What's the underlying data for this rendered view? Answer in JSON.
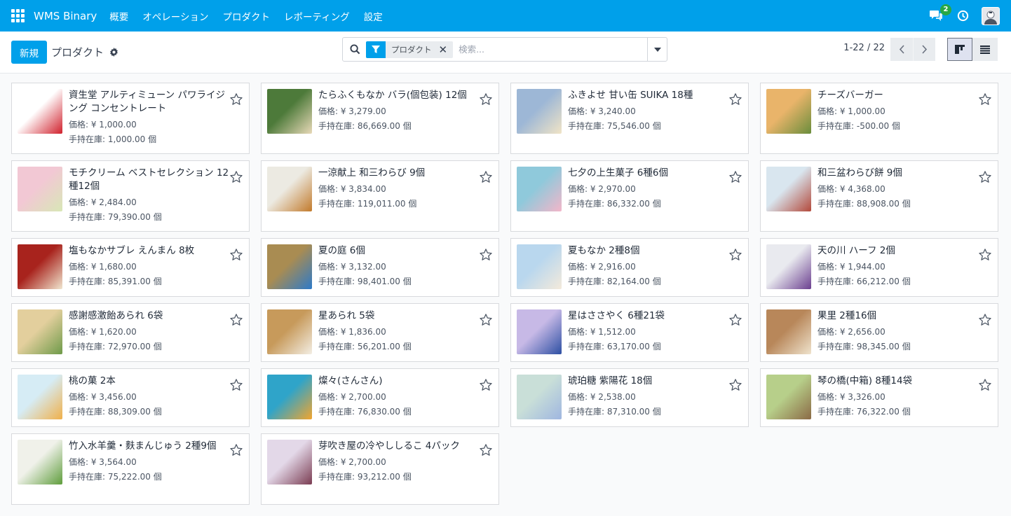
{
  "navbar": {
    "brand": "WMS Binary",
    "menu": [
      "概要",
      "オペレーション",
      "プロダクト",
      "レポーティング",
      "設定"
    ],
    "chat_badge": "2"
  },
  "control": {
    "new_label": "新規",
    "breadcrumb": "プロダクト",
    "facet_label": "プロダクト",
    "search_placeholder": "検索...",
    "pager": "1-22 / 22"
  },
  "colors": {
    "primary": "#00a0ea",
    "badge": "#28a745"
  },
  "products": [
    {
      "name": "資生堂 アルティミューン パワライジング コンセントレート",
      "price": "価格: ¥ 1,000.00",
      "stock": "手持在庫: 1,000.00 個",
      "thumb": [
        "#ffffff",
        "#d0202c"
      ]
    },
    {
      "name": "たらふくもなか バラ(個包装) 12個",
      "price": "価格: ¥ 3,279.00",
      "stock": "手持在庫: 86,669.00 個",
      "thumb": [
        "#4d7a3a",
        "#e8d9b8"
      ]
    },
    {
      "name": "ふきよせ 甘い缶 SUIKA 18種",
      "price": "価格: ¥ 3,240.00",
      "stock": "手持在庫: 75,546.00 個",
      "thumb": [
        "#9db7d6",
        "#f1e4c6"
      ]
    },
    {
      "name": "チーズバーガー",
      "price": "価格: ¥ 1,000.00",
      "stock": "手持在庫: -500.00 個",
      "thumb": [
        "#e9b46a",
        "#6a8d3c"
      ]
    },
    {
      "name": "モチクリーム ベストセレクション 12種12個",
      "price": "価格: ¥ 2,484.00",
      "stock": "手持在庫: 79,390.00 個",
      "thumb": [
        "#f2c8d4",
        "#d8e7b6"
      ]
    },
    {
      "name": "一涼献上 和三わらび 9個",
      "price": "価格: ¥ 3,834.00",
      "stock": "手持在庫: 119,011.00 個",
      "thumb": [
        "#eceae2",
        "#c27a2b"
      ]
    },
    {
      "name": "七夕の上生菓子 6種6個",
      "price": "価格: ¥ 2,970.00",
      "stock": "手持在庫: 86,332.00 個",
      "thumb": [
        "#8fc9db",
        "#f3b6c9"
      ]
    },
    {
      "name": "和三盆わらび餅 9個",
      "price": "価格: ¥ 4,368.00",
      "stock": "手持在庫: 88,908.00 個",
      "thumb": [
        "#d9e6ef",
        "#b3493b"
      ]
    },
    {
      "name": "塩もなかサブレ えんまん 8枚",
      "price": "価格: ¥ 1,680.00",
      "stock": "手持在庫: 85,391.00 個",
      "thumb": [
        "#a8231d",
        "#f0e6cf"
      ]
    },
    {
      "name": "夏の庭 6個",
      "price": "価格: ¥ 3,132.00",
      "stock": "手持在庫: 98,401.00 個",
      "thumb": [
        "#a98c52",
        "#2d7ac9"
      ]
    },
    {
      "name": "夏もなか 2種8個",
      "price": "価格: ¥ 2,916.00",
      "stock": "手持在庫: 82,164.00 個",
      "thumb": [
        "#b9d7ee",
        "#f4eadb"
      ]
    },
    {
      "name": "天の川 ハーフ 2個",
      "price": "価格: ¥ 1,944.00",
      "stock": "手持在庫: 66,212.00 個",
      "thumb": [
        "#e9eaef",
        "#6b3f8f"
      ]
    },
    {
      "name": "感謝感激飴あられ 6袋",
      "price": "価格: ¥ 1,620.00",
      "stock": "手持在庫: 72,970.00 個",
      "thumb": [
        "#e3cf9d",
        "#6e9a49"
      ]
    },
    {
      "name": "星あられ 5袋",
      "price": "価格: ¥ 1,836.00",
      "stock": "手持在庫: 56,201.00 個",
      "thumb": [
        "#c79a5b",
        "#f3eee4"
      ]
    },
    {
      "name": "星はささやく 6種21袋",
      "price": "価格: ¥ 1,512.00",
      "stock": "手持在庫: 63,170.00 個",
      "thumb": [
        "#c7b9e6",
        "#2d4fa3"
      ]
    },
    {
      "name": "果里 2種16個",
      "price": "価格: ¥ 2,656.00",
      "stock": "手持在庫: 98,345.00 個",
      "thumb": [
        "#b8875a",
        "#efe3cd"
      ]
    },
    {
      "name": "桃の菓 2本",
      "price": "価格: ¥ 3,456.00",
      "stock": "手持在庫: 88,309.00 個",
      "thumb": [
        "#d6ecf5",
        "#f0b04a"
      ]
    },
    {
      "name": "燦々(さんさん)",
      "price": "価格: ¥ 2,700.00",
      "stock": "手持在庫: 76,830.00 個",
      "thumb": [
        "#2fa4c9",
        "#f2a52e"
      ]
    },
    {
      "name": "琥珀糖 紫陽花 18個",
      "price": "価格: ¥ 2,538.00",
      "stock": "手持在庫: 87,310.00 個",
      "thumb": [
        "#c9dfd8",
        "#9fb6e0"
      ]
    },
    {
      "name": "琴の橋(中箱) 8種14袋",
      "price": "価格: ¥ 3,326.00",
      "stock": "手持在庫: 76,322.00 個",
      "thumb": [
        "#b7cf8a",
        "#8b6a45"
      ]
    },
    {
      "name": "竹入水羊羹・麩まんじゅう 2種9個",
      "price": "価格: ¥ 3,564.00",
      "stock": "手持在庫: 75,222.00 個",
      "thumb": [
        "#f0f1ea",
        "#5f9d3c"
      ]
    },
    {
      "name": "芽吹き屋の冷やししるこ 4パック",
      "price": "価格: ¥ 2,700.00",
      "stock": "手持在庫: 93,212.00 個",
      "thumb": [
        "#e3d8e8",
        "#7a3c52"
      ]
    }
  ]
}
